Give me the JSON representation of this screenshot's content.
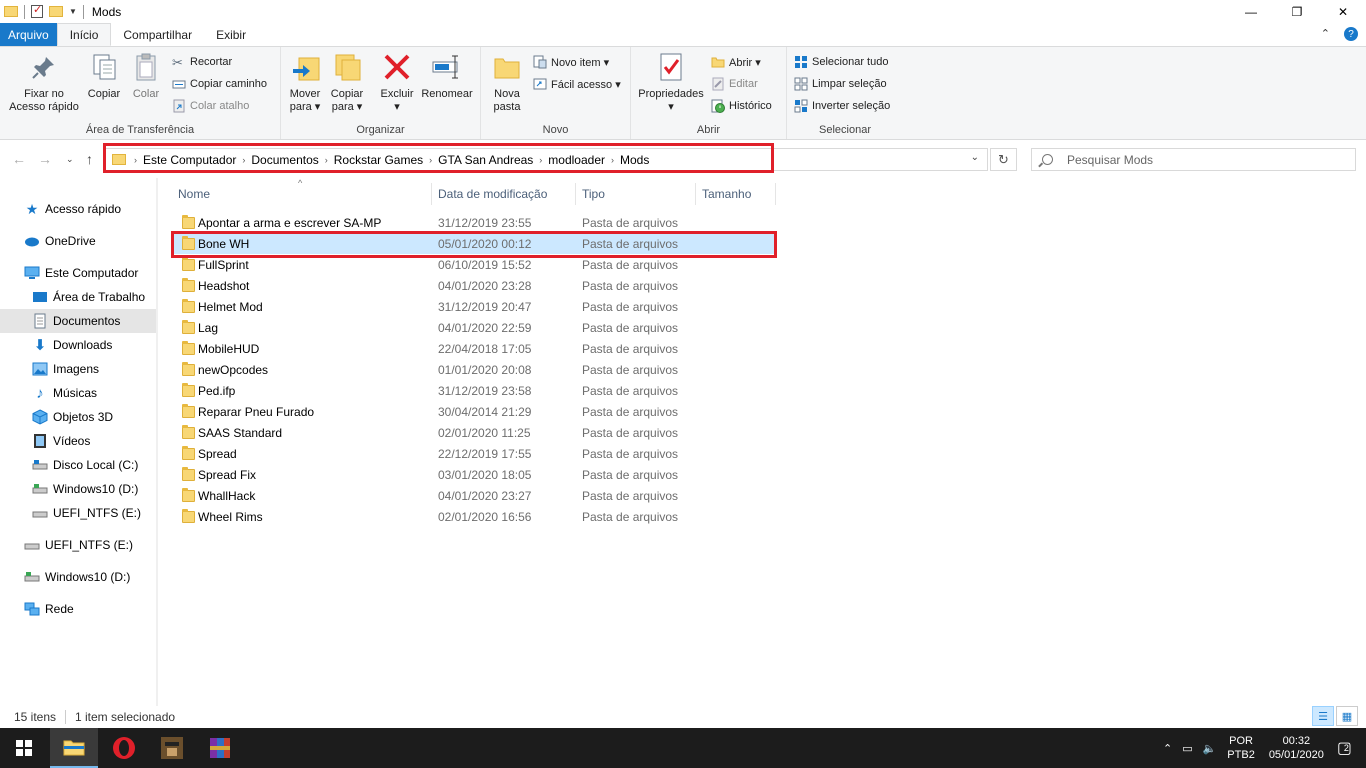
{
  "window": {
    "title": "Mods",
    "controls": {
      "minimize": "—",
      "maximize": "❐",
      "close": "✕"
    }
  },
  "ribbon_tabs": [
    {
      "label": "Arquivo"
    },
    {
      "label": "Início"
    },
    {
      "label": "Compartilhar"
    },
    {
      "label": "Exibir"
    }
  ],
  "ribbon": {
    "clipboard": {
      "label": "Área de Transferência",
      "pin": "Fixar no\nAcesso rápido",
      "copy": "Copiar",
      "paste": "Colar",
      "cut": "Recortar",
      "copy_path": "Copiar caminho",
      "paste_shortcut": "Colar atalho"
    },
    "organize": {
      "label": "Organizar",
      "move_to": "Mover\npara ▾",
      "copy_to": "Copiar\npara ▾",
      "delete": "Excluir\n▾",
      "rename": "Renomear"
    },
    "new": {
      "label": "Novo",
      "new_folder": "Nova\npasta",
      "new_item": "Novo item ▾",
      "easy_access": "Fácil acesso ▾"
    },
    "open": {
      "label": "Abrir",
      "properties": "Propriedades\n▾",
      "open": "Abrir ▾",
      "edit": "Editar",
      "history": "Histórico"
    },
    "select": {
      "label": "Selecionar",
      "select_all": "Selecionar tudo",
      "select_none": "Limpar seleção",
      "invert": "Inverter seleção"
    }
  },
  "address": {
    "crumbs": [
      "Este Computador",
      "Documentos",
      "Rockstar Games",
      "GTA San Andreas",
      "modloader",
      "Mods"
    ],
    "search_placeholder": "Pesquisar Mods"
  },
  "nav_pane": [
    {
      "label": "Acesso rápido",
      "icon": "star-icon"
    },
    {
      "label": "OneDrive",
      "icon": "cloud-icon"
    },
    {
      "label": "Este Computador",
      "icon": "computer-icon"
    },
    {
      "label": "Área de Trabalho",
      "icon": "desktop-icon"
    },
    {
      "label": "Documentos",
      "icon": "document-icon"
    },
    {
      "label": "Downloads",
      "icon": "download-icon"
    },
    {
      "label": "Imagens",
      "icon": "image-icon"
    },
    {
      "label": "Músicas",
      "icon": "music-icon"
    },
    {
      "label": "Objetos 3D",
      "icon": "cube-icon"
    },
    {
      "label": "Vídeos",
      "icon": "video-icon"
    },
    {
      "label": "Disco Local (C:)",
      "icon": "drive-icon"
    },
    {
      "label": "Windows10 (D:)",
      "icon": "drive-icon"
    },
    {
      "label": "UEFI_NTFS (E:)",
      "icon": "drive-icon"
    },
    {
      "label": "UEFI_NTFS (E:)",
      "icon": "drive-icon"
    },
    {
      "label": "Windows10 (D:)",
      "icon": "drive-icon"
    },
    {
      "label": "Rede",
      "icon": "network-icon"
    }
  ],
  "columns": {
    "name": "Nome",
    "date": "Data de modificação",
    "type": "Tipo",
    "size": "Tamanho"
  },
  "files": [
    {
      "name": "Apontar a arma e escrever SA-MP",
      "date": "31/12/2019 23:55",
      "type": "Pasta de arquivos"
    },
    {
      "name": "Bone WH",
      "date": "05/01/2020 00:12",
      "type": "Pasta de arquivos"
    },
    {
      "name": "FullSprint",
      "date": "06/10/2019 15:52",
      "type": "Pasta de arquivos"
    },
    {
      "name": "Headshot",
      "date": "04/01/2020 23:28",
      "type": "Pasta de arquivos"
    },
    {
      "name": "Helmet Mod",
      "date": "31/12/2019 20:47",
      "type": "Pasta de arquivos"
    },
    {
      "name": "Lag",
      "date": "04/01/2020 22:59",
      "type": "Pasta de arquivos"
    },
    {
      "name": "MobileHUD",
      "date": "22/04/2018 17:05",
      "type": "Pasta de arquivos"
    },
    {
      "name": "newOpcodes",
      "date": "01/01/2020 20:08",
      "type": "Pasta de arquivos"
    },
    {
      "name": "Ped.ifp",
      "date": "31/12/2019 23:58",
      "type": "Pasta de arquivos"
    },
    {
      "name": "Reparar Pneu Furado",
      "date": "30/04/2014 21:29",
      "type": "Pasta de arquivos"
    },
    {
      "name": "SAAS Standard",
      "date": "02/01/2020 11:25",
      "type": "Pasta de arquivos"
    },
    {
      "name": "Spread",
      "date": "22/12/2019 17:55",
      "type": "Pasta de arquivos"
    },
    {
      "name": "Spread Fix",
      "date": "03/01/2020 18:05",
      "type": "Pasta de arquivos"
    },
    {
      "name": "WhallHack",
      "date": "04/01/2020 23:27",
      "type": "Pasta de arquivos"
    },
    {
      "name": "Wheel Rims",
      "date": "02/01/2020 16:56",
      "type": "Pasta de arquivos"
    }
  ],
  "status": {
    "count": "15 itens",
    "selected": "1 item selecionado"
  },
  "taskbar": {
    "lang_top": "POR",
    "lang_bottom": "PTB2",
    "time": "00:32",
    "date": "05/01/2020",
    "notifications": "2"
  },
  "colors": {
    "accent": "#1979ca",
    "highlight": "#e0202a",
    "selection": "#cce8ff",
    "folder": "#f8d775"
  }
}
